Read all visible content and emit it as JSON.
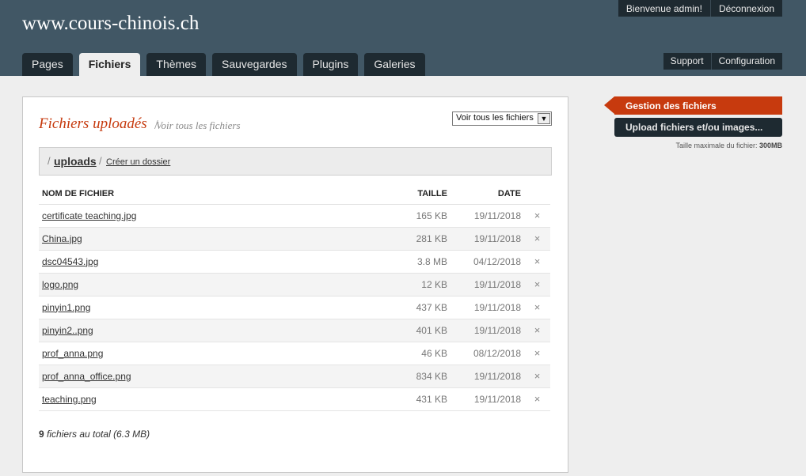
{
  "header": {
    "site_title": "www.cours-chinois.ch",
    "top_links": [
      "Bienvenue admin!",
      "Déconnexion"
    ],
    "tabs": [
      {
        "label": "Pages",
        "active": false
      },
      {
        "label": "Fichiers",
        "active": true
      },
      {
        "label": "Thèmes",
        "active": false
      },
      {
        "label": "Sauvegardes",
        "active": false
      },
      {
        "label": "Plugins",
        "active": false
      },
      {
        "label": "Galeries",
        "active": false
      }
    ],
    "secondary_links": [
      "Support",
      "Configuration"
    ]
  },
  "main": {
    "title": "Fichiers uploadés",
    "subtitle": "Voir tous les fichiers",
    "filter_select": "Voir tous les fichiers",
    "path": {
      "separator": "/",
      "folder": "uploads",
      "create_folder": "Créer un dossier"
    },
    "columns": {
      "name": "NOM DE FICHIER",
      "size": "TAILLE",
      "date": "DATE"
    },
    "files": [
      {
        "name": "certificate teaching.jpg",
        "size": "165 KB",
        "date": "19/11/2018"
      },
      {
        "name": "China.jpg",
        "size": "281 KB",
        "date": "19/11/2018"
      },
      {
        "name": "dsc04543.jpg",
        "size": "3.8 MB",
        "date": "04/12/2018"
      },
      {
        "name": "logo.png",
        "size": "12 KB",
        "date": "19/11/2018"
      },
      {
        "name": "pinyin1.png",
        "size": "437 KB",
        "date": "19/11/2018"
      },
      {
        "name": "pinyin2..png",
        "size": "401 KB",
        "date": "19/11/2018"
      },
      {
        "name": "prof_anna.png",
        "size": "46 KB",
        "date": "08/12/2018"
      },
      {
        "name": "prof_anna_office.png",
        "size": "834 KB",
        "date": "19/11/2018"
      },
      {
        "name": "teaching.png",
        "size": "431 KB",
        "date": "19/11/2018"
      }
    ],
    "delete_glyph": "×",
    "total_count": "9",
    "total_text": " fichiers au total (6.3 MB)"
  },
  "sidebar": {
    "active_label": "Gestion des fichiers",
    "upload_label": "Upload fichiers et/ou images...",
    "max_label": "Taille maximale du fichier: ",
    "max_value": "300MB"
  },
  "colors": {
    "header_bg": "#415765",
    "accent": "#c73a0e",
    "dark": "#1e2a31"
  }
}
